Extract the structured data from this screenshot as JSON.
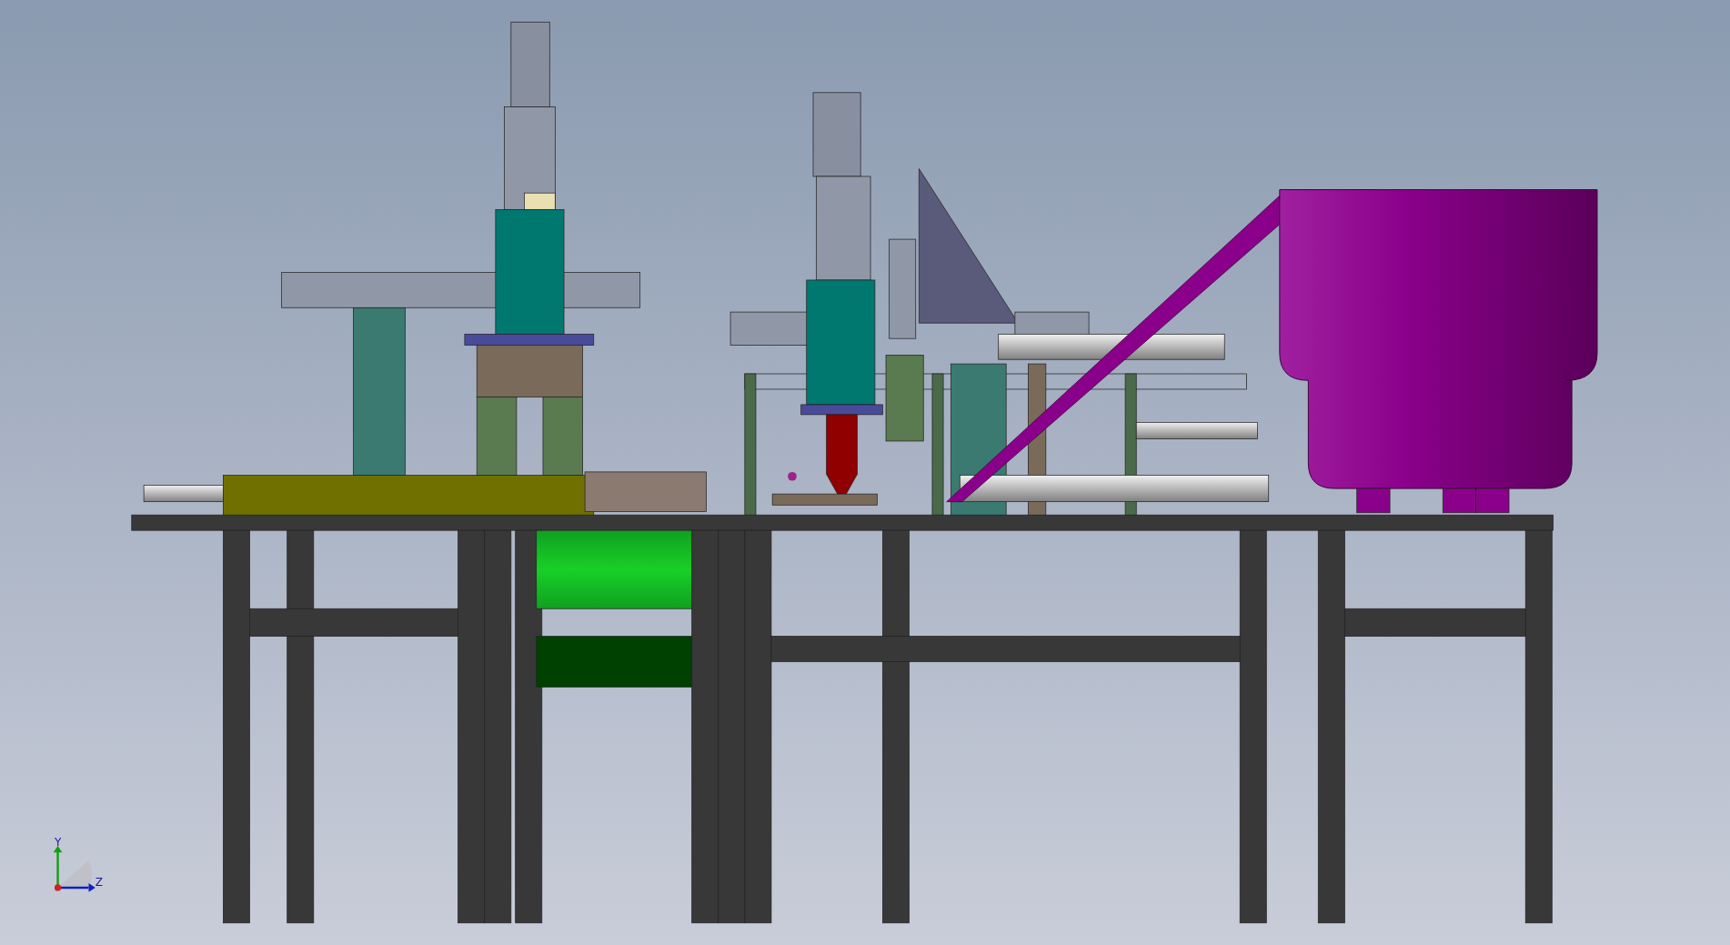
{
  "viewport": {
    "axis_triad": {
      "labels": [
        "Y",
        "Z"
      ]
    }
  }
}
